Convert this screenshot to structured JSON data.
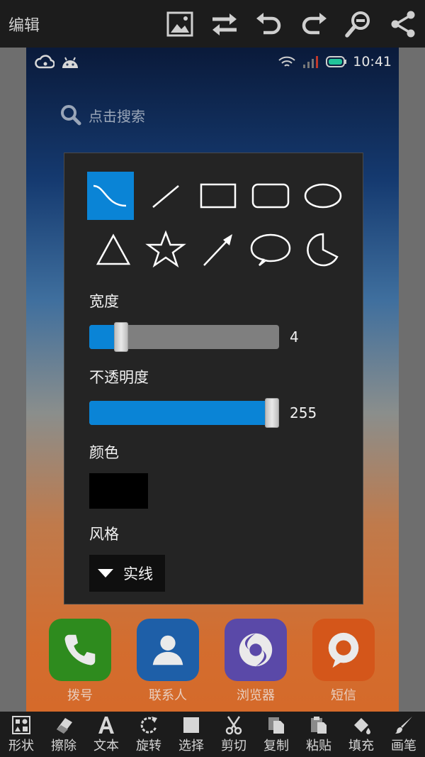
{
  "topbar": {
    "title": "编辑",
    "actions": [
      {
        "name": "image-icon"
      },
      {
        "name": "swap-icon"
      },
      {
        "name": "undo-icon"
      },
      {
        "name": "redo-icon"
      },
      {
        "name": "zoom-out-icon"
      },
      {
        "name": "share-icon"
      }
    ]
  },
  "background": {
    "status_time": "10:41",
    "search_placeholder": "点击搜索",
    "apps": [
      {
        "label": "拨号",
        "color": "#2e8b1e",
        "icon": "phone-icon"
      },
      {
        "label": "联系人",
        "color": "#1e5fa8",
        "icon": "contacts-icon"
      },
      {
        "label": "浏览器",
        "color": "#5a49a8",
        "icon": "browser-icon"
      },
      {
        "label": "短信",
        "color": "#d4561a",
        "icon": "message-icon"
      }
    ]
  },
  "dialog": {
    "shapes": [
      "curve-icon",
      "line-icon",
      "rectangle-icon",
      "rounded-rectangle-icon",
      "ellipse-icon",
      "triangle-icon",
      "star-icon",
      "arrow-icon",
      "speech-bubble-icon",
      "pie-icon"
    ],
    "selected_shape": "curve-icon",
    "width_label": "宽度",
    "width_value": "4",
    "width_fraction": 0.14,
    "opacity_label": "不透明度",
    "opacity_value": "255",
    "opacity_fraction": 1.0,
    "color_label": "颜色",
    "color_value": "#000000",
    "style_label": "风格",
    "style_value": "实线"
  },
  "colors": {
    "accent": "#0a84d6",
    "bar_bg": "#1c1c1c",
    "dialog_bg": "#242424"
  },
  "bottombar": {
    "tools": [
      {
        "label": "形状",
        "icon": "shapes-icon"
      },
      {
        "label": "擦除",
        "icon": "eraser-icon"
      },
      {
        "label": "文本",
        "icon": "text-icon"
      },
      {
        "label": "旋转",
        "icon": "rotate-icon"
      },
      {
        "label": "选择",
        "icon": "select-icon"
      },
      {
        "label": "剪切",
        "icon": "scissors-icon"
      },
      {
        "label": "复制",
        "icon": "copy-icon"
      },
      {
        "label": "粘贴",
        "icon": "paste-icon"
      },
      {
        "label": "填充",
        "icon": "fill-icon"
      },
      {
        "label": "画笔",
        "icon": "brush-icon"
      }
    ]
  }
}
